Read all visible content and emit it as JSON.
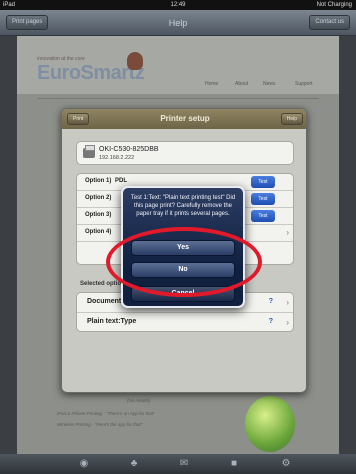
{
  "status_bar": {
    "device": "iPad",
    "time": "12:49",
    "battery": "Not Charging"
  },
  "nav_bar": {
    "title": "Help",
    "left_button": "Print pages",
    "right_button": "Contact us"
  },
  "web": {
    "tagline": "innovation at the core",
    "logo": "EuroSmartz",
    "nav": [
      "Home",
      "About",
      "News",
      "Support"
    ],
    "bottom_lines": [
      "(No results)",
      "iPad & iPhone Printing - \"There's an App for that\"",
      "Wireless Printing - \"Here's the app for that\""
    ]
  },
  "printer_setup": {
    "title": "Printer setup",
    "left_button": "Print",
    "right_button": "Help",
    "printer_name": "OKI-C530-825DBB",
    "printer_ip": "192.168.2.222",
    "options": [
      {
        "label": "Option 1)",
        "value": "PDL",
        "test": "Test"
      },
      {
        "label": "Option 2)",
        "value": "",
        "test": "Test"
      },
      {
        "label": "Option 3)",
        "value": "",
        "test": "Test"
      },
      {
        "label": "Option 4)",
        "value": "",
        "test": ""
      }
    ],
    "selected_options_title": "Selected options",
    "selected": [
      {
        "label": "Documents/Images:Type",
        "help": "?"
      },
      {
        "label": "Plain text:Type",
        "help": "?"
      }
    ]
  },
  "alert": {
    "message": "Test 1:Text: \"Plain text printing test\" Did this page print? Carefully remove the paper tray if it prints several pages.",
    "yes": "Yes",
    "no": "No",
    "cancel": "Cancel"
  },
  "colors": {
    "highlight_ring": "#e0192b",
    "test_button": "#2a5fc8"
  }
}
